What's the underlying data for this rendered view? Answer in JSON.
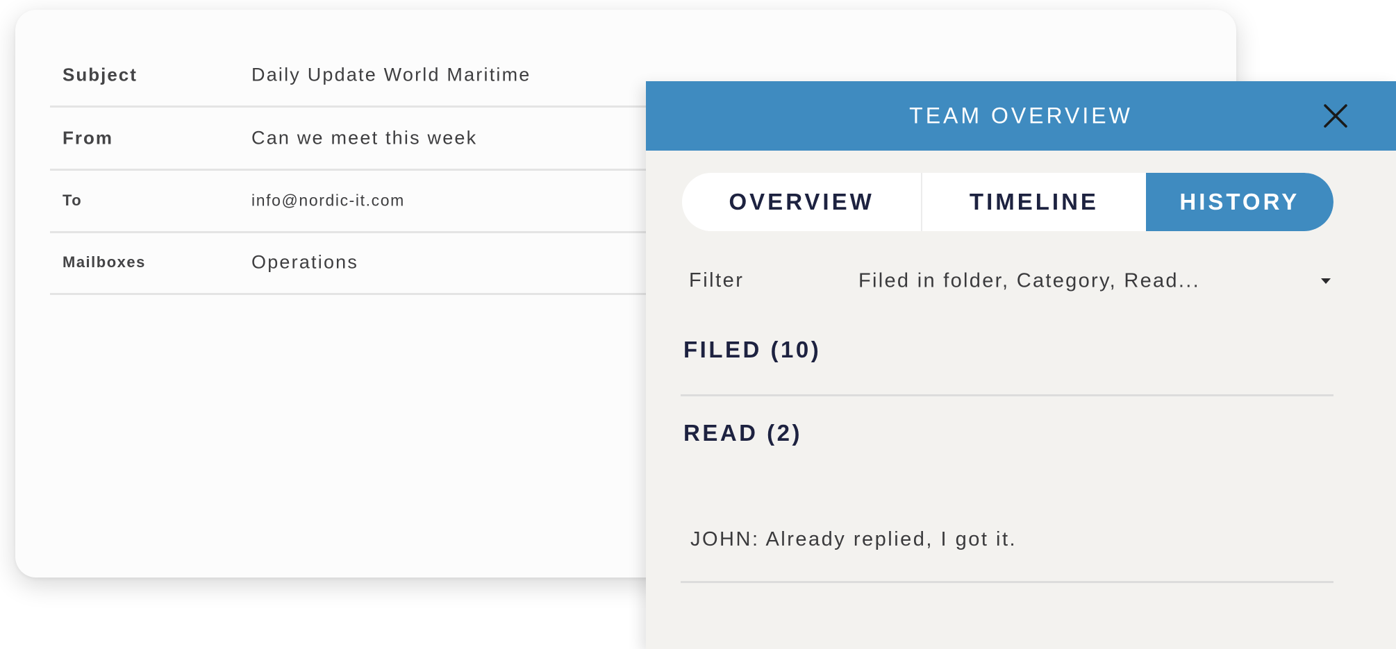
{
  "email_details": {
    "rows": [
      {
        "label": "Subject",
        "value": "Daily Update World Maritime"
      },
      {
        "label": "From",
        "value": "Can we meet this week"
      },
      {
        "label": "To",
        "value": "info@nordic-it.com"
      },
      {
        "label": "Mailboxes",
        "value": "Operations"
      }
    ]
  },
  "panel": {
    "title": "TEAM OVERVIEW",
    "close_icon": "close-icon",
    "tabs": [
      {
        "label": "OVERVIEW",
        "active": false
      },
      {
        "label": "TIMELINE",
        "active": false
      },
      {
        "label": "HISTORY",
        "active": true
      }
    ],
    "filter": {
      "label": "Filter",
      "value": "Filed in folder, Category, Read...",
      "icon": "chevron-down-icon"
    },
    "sections": [
      {
        "title": "FILED (10)"
      },
      {
        "title": "READ (2)"
      }
    ],
    "history_items": [
      {
        "text": "JOHN: Already replied, I got it."
      }
    ]
  },
  "colors": {
    "accent": "#3f8bc0",
    "panel_bg": "#f3f2ef",
    "heading_text": "#1d2240",
    "card_bg": "#fcfcfc"
  }
}
